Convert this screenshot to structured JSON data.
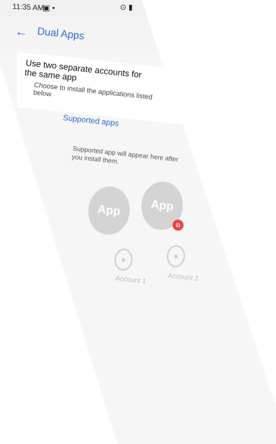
{
  "status_bar": {
    "time": "11:35 AM",
    "left_icons": "▣  •",
    "right_icons": "⊙ ▮"
  },
  "app_bar": {
    "title": "Dual Apps",
    "back_icon": "arrow-left-icon"
  },
  "header": {
    "title": "Use two separate accounts for the same app",
    "subtitle": "Choose to install the applications listed below"
  },
  "supported_apps": {
    "link": "Supported apps",
    "note": "Supported app will appear here after you install them."
  },
  "demo": {
    "app1_label": "App",
    "app2_label": "App",
    "account1": "Account 1",
    "account2": "Account 2"
  },
  "colors": {
    "accent": "#2f6bd0",
    "badge": "#e64545",
    "placeholder": "#d4d4d4"
  }
}
